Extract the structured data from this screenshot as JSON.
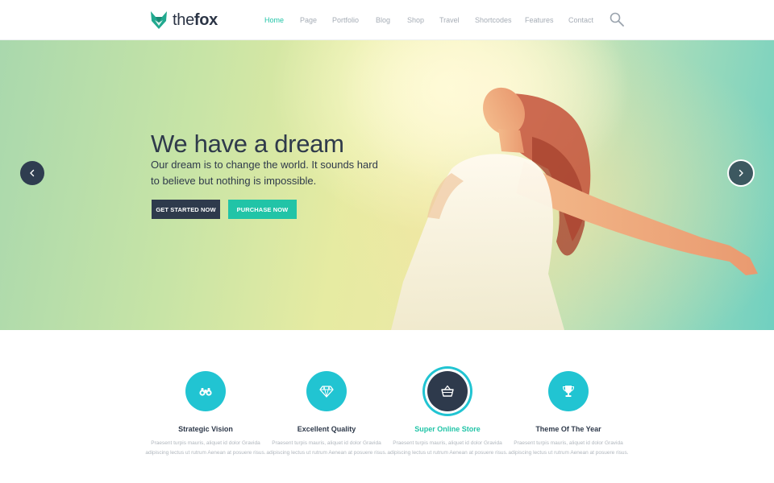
{
  "brand": {
    "name_light": "the",
    "name_bold": "fox",
    "accent": "#21c4a7",
    "dark": "#2e3a4c"
  },
  "nav": {
    "items": [
      {
        "label": "Home",
        "active": true
      },
      {
        "label": "Page"
      },
      {
        "label": "Portfolio"
      },
      {
        "label": "Blog"
      },
      {
        "label": "Shop"
      },
      {
        "label": "Travel"
      },
      {
        "label": "Shortcodes"
      },
      {
        "label": "Features"
      },
      {
        "label": "Contact"
      }
    ],
    "search_icon": "search-icon"
  },
  "hero": {
    "title": "We have a dream",
    "text": "Our dream is to change the world. It sounds hard to believe but nothing is impossible.",
    "primary_button": "GET STARTED NOW",
    "secondary_button": "PURCHASE NOW",
    "prev_icon": "chevron-left-icon",
    "next_icon": "chevron-right-icon"
  },
  "features": [
    {
      "icon": "binoculars-icon",
      "title": "Strategic Vision",
      "text": "Praesent turpis mauris, aliquet id dolor Gravida adipiscing lectus ut rutrum Aenean at posuere risus."
    },
    {
      "icon": "diamond-icon",
      "title": "Excellent Quality",
      "text": "Praesent turpis mauris, aliquet id dolor Gravida adipiscing lectus ut rutrum Aenean at posuere risus."
    },
    {
      "icon": "basket-icon",
      "title": "Super Online Store",
      "text": "Praesent turpis mauris, aliquet id dolor Gravida adipiscing lectus ut rutrum Aenean at posuere risus.",
      "highlighted": true
    },
    {
      "icon": "trophy-icon",
      "title": "Theme Of The Year",
      "text": "Praesent turpis mauris, aliquet id dolor Gravida adipiscing lectus ut rutrum Aenean at posuere risus."
    }
  ]
}
